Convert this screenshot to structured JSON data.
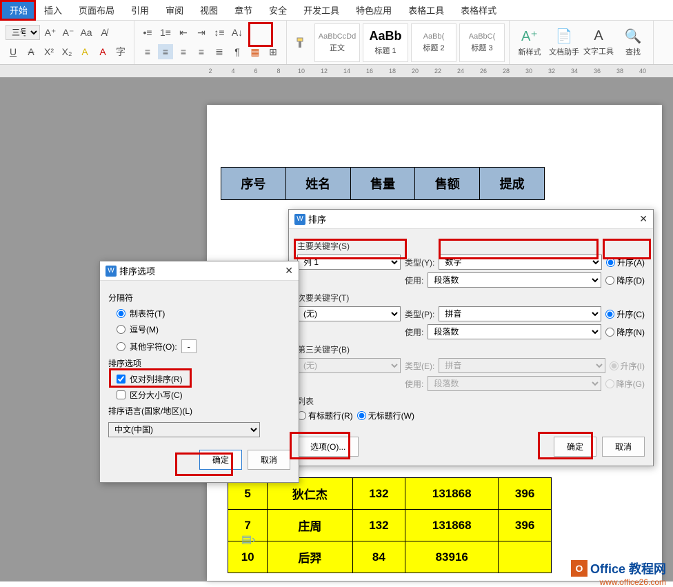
{
  "menu": {
    "tabs": [
      "开始",
      "插入",
      "页面布局",
      "引用",
      "审阅",
      "视图",
      "章节",
      "安全",
      "开发工具",
      "特色应用",
      "表格工具",
      "表格样式"
    ]
  },
  "ribbon": {
    "font_size": "三号",
    "styles": [
      {
        "preview": "AaBbCcDd",
        "label": "正文"
      },
      {
        "preview": "AaBb",
        "label": "标题 1"
      },
      {
        "preview": "AaBb(",
        "label": "标题 2"
      },
      {
        "preview": "AaBbC(",
        "label": "标题 3"
      }
    ],
    "new_style": "新样式",
    "doc_helper": "文档助手",
    "text_tool": "文字工具",
    "find": "查找"
  },
  "ruler": [
    "2",
    "4",
    "6",
    "8",
    "10",
    "12",
    "14",
    "16",
    "18",
    "20",
    "22",
    "24",
    "26",
    "28",
    "30",
    "32",
    "34",
    "36",
    "38",
    "40"
  ],
  "table": {
    "headers": [
      "序号",
      "姓名",
      "售量",
      "售额",
      "提成"
    ],
    "rows": [
      [
        "5",
        "狄仁杰",
        "132",
        "131868",
        "396"
      ],
      [
        "7",
        "庄周",
        "132",
        "131868",
        "396"
      ],
      [
        "10",
        "后羿",
        "84",
        "83916",
        ""
      ]
    ]
  },
  "sort_dialog": {
    "title": "排序",
    "primary_label": "主要关键字(S)",
    "secondary_label": "次要关键字(T)",
    "third_label": "第三关键字(B)",
    "type_label_y": "类型(Y):",
    "type_label_p": "类型(P):",
    "type_label_e": "类型(E):",
    "use_label": "使用:",
    "col_sel": "列 1",
    "none_sel": "(无)",
    "type_number": "数字",
    "type_pinyin": "拼音",
    "use_para": "段落数",
    "asc_a": "升序(A)",
    "desc_d": "降序(D)",
    "asc_c": "升序(C)",
    "desc_n": "降序(N)",
    "asc_i": "升序(I)",
    "desc_g": "降序(G)",
    "list_label": "列表",
    "has_header": "有标题行(R)",
    "no_header": "无标题行(W)",
    "options_btn": "选项(O)...",
    "ok": "确定",
    "cancel": "取消"
  },
  "sortopt_dialog": {
    "title": "排序选项",
    "sep_label": "分隔符",
    "tab": "制表符(T)",
    "comma": "逗号(M)",
    "other": "其他字符(O):",
    "other_val": "-",
    "options_label": "排序选项",
    "col_only": "仅对列排序(R)",
    "case_sens": "区分大小写(C)",
    "lang_label": "排序语言(国家/地区)(L)",
    "lang_val": "中文(中国)",
    "ok": "确定",
    "cancel": "取消"
  },
  "watermark": {
    "text": "Office 教程网",
    "url": "www.office26.com"
  }
}
